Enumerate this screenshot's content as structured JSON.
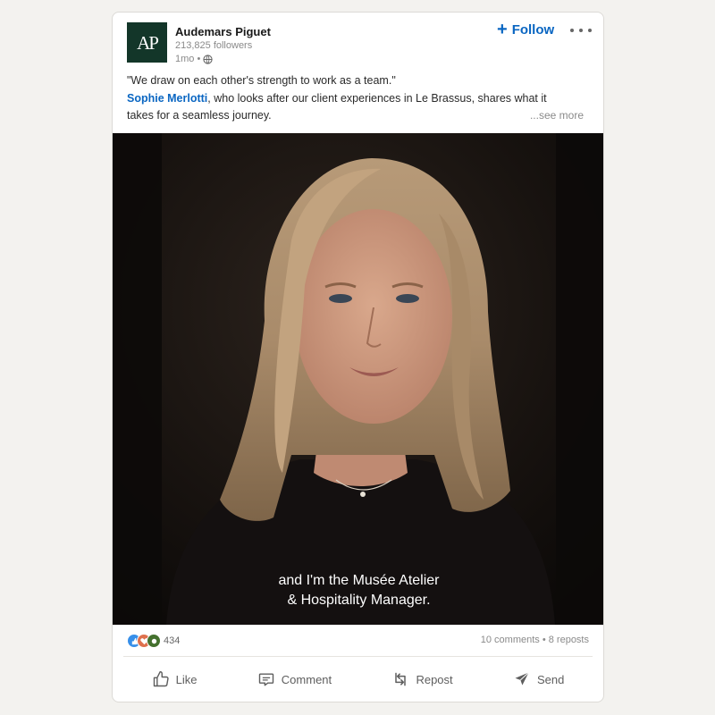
{
  "post": {
    "author": {
      "name": "Audemars Piguet",
      "followers": "213,825 followers",
      "time": "1mo •",
      "logo_text": "AP",
      "logo_color": "#133629"
    },
    "follow_label": "Follow",
    "more_icon": "ellipsis-icon",
    "text": {
      "line1": "\"We draw on each other's strength to work as a team.\"",
      "mention": "Sophie Merlotti",
      "line2_rest": ", who looks after our client experiences in Le Brassus, shares what it",
      "line3": "takes for a seamless journey.",
      "see_more": "...see more"
    },
    "video": {
      "caption_line1": "and I'm the Musée Atelier",
      "caption_line2": "& Hospitality Manager."
    },
    "stats": {
      "reaction_count": "434",
      "comments_reposts": "10 comments • 8 reposts"
    },
    "actions": [
      {
        "label": "Like",
        "icon": "like-icon"
      },
      {
        "label": "Comment",
        "icon": "comment-icon"
      },
      {
        "label": "Repost",
        "icon": "repost-icon"
      },
      {
        "label": "Send",
        "icon": "send-icon"
      }
    ],
    "colors": {
      "accent": "#0a66c2",
      "background": "#f3f2ef"
    }
  }
}
